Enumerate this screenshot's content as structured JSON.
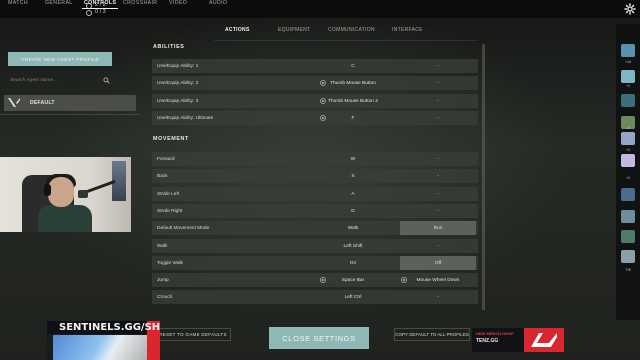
{
  "header": {
    "counters": [
      "2 / 2",
      "0 / 3"
    ],
    "tabs": [
      {
        "label": "MATCH",
        "active": false
      },
      {
        "label": "GENERAL",
        "active": false
      },
      {
        "label": "CONTROLS",
        "active": true
      },
      {
        "label": "CROSSHAIR",
        "active": false
      },
      {
        "label": "VIDEO",
        "active": false
      },
      {
        "label": "AUDIO",
        "active": false
      }
    ],
    "settings_icon": "gear-icon"
  },
  "subtabs": [
    {
      "label": "ACTIONS",
      "active": true
    },
    {
      "label": "EQUIPMENT",
      "active": false
    },
    {
      "label": "COMMUNICATION",
      "active": false
    },
    {
      "label": "INTERFACE",
      "active": false
    }
  ],
  "profiles": {
    "create_label": "CREATE NEW AGENT PROFILE",
    "search_placeholder": "Search Agent Name...",
    "items": [
      {
        "label": "DEFAULT",
        "icon": "valorant-logo-icon"
      }
    ]
  },
  "sections": [
    {
      "title": "ABILITIES",
      "rows": [
        {
          "action": "Use/Equip Ability: 1",
          "primary": "C",
          "primary_x": false,
          "secondary": "-",
          "secondary_x": false,
          "secondary_hl": false
        },
        {
          "action": "Use/Equip Ability: 2",
          "primary": "Thumb Mouse Button",
          "primary_x": true,
          "secondary": "-",
          "secondary_x": false,
          "secondary_hl": false
        },
        {
          "action": "Use/Equip Ability: 3",
          "primary": "Thumb Mouse Button 2",
          "primary_x": true,
          "secondary": "-",
          "secondary_x": false,
          "secondary_hl": false
        },
        {
          "action": "Use/Equip Ability: Ultimate",
          "primary": "F",
          "primary_x": true,
          "secondary": "-",
          "secondary_x": false,
          "secondary_hl": false
        }
      ]
    },
    {
      "title": "MOVEMENT",
      "rows": [
        {
          "action": "Forward",
          "primary": "W",
          "primary_x": false,
          "secondary": "-",
          "secondary_x": false,
          "secondary_hl": false
        },
        {
          "action": "Back",
          "primary": "S",
          "primary_x": false,
          "secondary": "-",
          "secondary_x": false,
          "secondary_hl": false
        },
        {
          "action": "Strafe Left",
          "primary": "A",
          "primary_x": false,
          "secondary": "-",
          "secondary_x": false,
          "secondary_hl": false
        },
        {
          "action": "Strafe Right",
          "primary": "D",
          "primary_x": false,
          "secondary": "-",
          "secondary_x": false,
          "secondary_hl": false
        },
        {
          "action": "Default Movement Mode",
          "primary": "Walk",
          "primary_x": false,
          "secondary": "Run",
          "secondary_x": false,
          "secondary_hl": true
        },
        {
          "action": "Walk",
          "primary": "Left Shift",
          "primary_x": false,
          "secondary": "-",
          "secondary_x": false,
          "secondary_hl": false
        },
        {
          "action": "Toggle Walk",
          "primary": "On",
          "primary_x": false,
          "secondary": "Off",
          "secondary_x": false,
          "secondary_hl": true
        },
        {
          "action": "Jump",
          "primary": "Space Bar",
          "primary_x": true,
          "secondary": "Mouse Wheel Down",
          "secondary_x": true,
          "secondary_hl": false
        },
        {
          "action": "Crouch",
          "primary": "Left Ctrl",
          "primary_x": false,
          "secondary": "-",
          "secondary_x": false,
          "secondary_hl": false
        }
      ]
    }
  ],
  "footer": {
    "reset_label": "RESET TO GAME DEFAULTS",
    "close_label": "CLOSE SETTINGS",
    "copy_label": "COPY DEFAULT TO ALL PROFILES"
  },
  "overlays": {
    "sponsor_text": "SENTINELS.GG/SHOP",
    "sponsor2_line1": "NEW MERCH DROP",
    "sponsor2_line2": "TENZ.GG"
  },
  "right_strip": {
    "labels": [
      "+14",
      "+1",
      "-8",
      "+1",
      "+1",
      "T/8"
    ]
  },
  "colors": {
    "accent": "#8db8b3",
    "row_bg": "#3a3e38",
    "highlight": "#5e615b"
  }
}
